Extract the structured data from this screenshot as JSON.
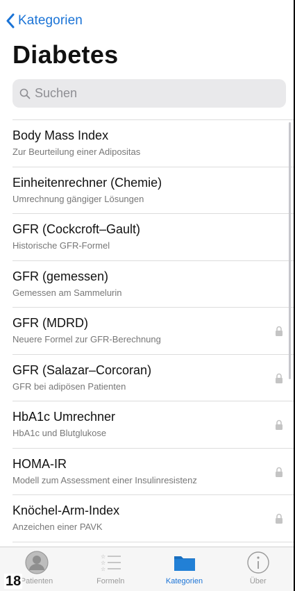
{
  "nav": {
    "back_label": "Kategorien"
  },
  "page_title": "Diabetes",
  "search": {
    "placeholder": "Suchen"
  },
  "items": [
    {
      "title": "Body Mass Index",
      "subtitle": "Zur Beurteilung einer Adipositas",
      "locked": false
    },
    {
      "title": "Einheitenrechner (Chemie)",
      "subtitle": "Umrechnung gängiger Lösungen",
      "locked": false
    },
    {
      "title": "GFR (Cockcroft–Gault)",
      "subtitle": "Historische GFR-Formel",
      "locked": false
    },
    {
      "title": "GFR (gemessen)",
      "subtitle": "Gemessen am Sammelurin",
      "locked": false
    },
    {
      "title": "GFR (MDRD)",
      "subtitle": "Neuere Formel zur GFR-Berechnung",
      "locked": true
    },
    {
      "title": "GFR (Salazar–Corcoran)",
      "subtitle": "GFR bei adipösen Patienten",
      "locked": true
    },
    {
      "title": "HbA1c Umrechner",
      "subtitle": "HbA1c und Blutglukose",
      "locked": true
    },
    {
      "title": "HOMA-IR",
      "subtitle": "Modell zum Assessment einer Insulinresistenz",
      "locked": true
    },
    {
      "title": "Knöchel-Arm-Index",
      "subtitle": "Anzeichen einer PAVK",
      "locked": true
    }
  ],
  "tabs": [
    {
      "label": "Patienten",
      "icon": "person-icon",
      "active": false
    },
    {
      "label": "Formeln",
      "icon": "list-stars-icon",
      "active": false
    },
    {
      "label": "Kategorien",
      "icon": "folder-icon",
      "active": true
    },
    {
      "label": "Über",
      "icon": "info-icon",
      "active": false
    }
  ],
  "page_number": "18",
  "colors": {
    "accent": "#1a73d6",
    "inactive": "#9a9a9a",
    "search_bg": "#e9e9eb"
  }
}
